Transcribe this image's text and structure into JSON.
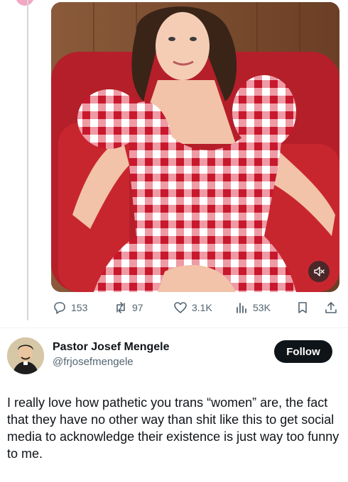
{
  "tweet_media": {
    "type": "video",
    "mute_icon": "speaker-muted-icon"
  },
  "actions": {
    "replies": "153",
    "retweets": "97",
    "likes": "3.1K",
    "views": "53K"
  },
  "reply_author": {
    "display_name": "Pastor Josef Mengele",
    "handle": "@frjosefmengele",
    "follow_label": "Follow"
  },
  "reply_text": "I really love how pathetic you trans “women” are, the fact that they have no other way than shit like this to get social media to acknowledge their existence is just way too funny to me.",
  "colors": {
    "text_primary": "#0f1419",
    "text_secondary": "#536471",
    "follow_bg": "#0f1419",
    "thread_line": "#cfd9de"
  }
}
